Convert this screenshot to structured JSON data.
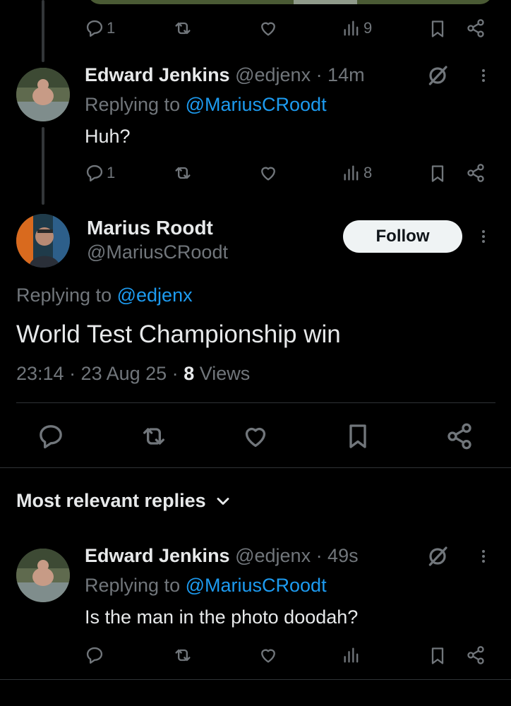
{
  "reply1_actions": {
    "replies": "1",
    "views": "9"
  },
  "reply2": {
    "name": "Edward Jenkins",
    "handle_time": "@edjenx · 14m",
    "replying_prefix": "Replying to",
    "replying_handle": "@MariusCRoodt",
    "text": "Huh?",
    "replies": "1",
    "views": "8"
  },
  "main_tweet": {
    "name": "Marius Roodt",
    "handle": "@MariusCRoodt",
    "follow_label": "Follow",
    "replying_prefix": "Replying to",
    "replying_handle": "@edjenx",
    "text": "World Test Championship win",
    "time": "23:14 · 23 Aug 25 · ",
    "views_count": "8",
    "views_label": "Views"
  },
  "replies_filter": {
    "label": "Most relevant replies"
  },
  "reply3": {
    "name": "Edward Jenkins",
    "handle_time": "@edjenx · 49s",
    "replying_prefix": "Replying to",
    "replying_handle": "@MariusCRoodt",
    "text": "Is the man in the photo doodah?"
  },
  "colors": {
    "background": "#000000",
    "text": "#e7e9ea",
    "muted": "#71767b",
    "link": "#1d9bf0"
  },
  "icons": [
    "reply-icon",
    "retweet-icon",
    "like-icon",
    "views-icon",
    "bookmark-icon",
    "share-icon",
    "grok-icon",
    "more-icon",
    "chevron-down-icon"
  ]
}
